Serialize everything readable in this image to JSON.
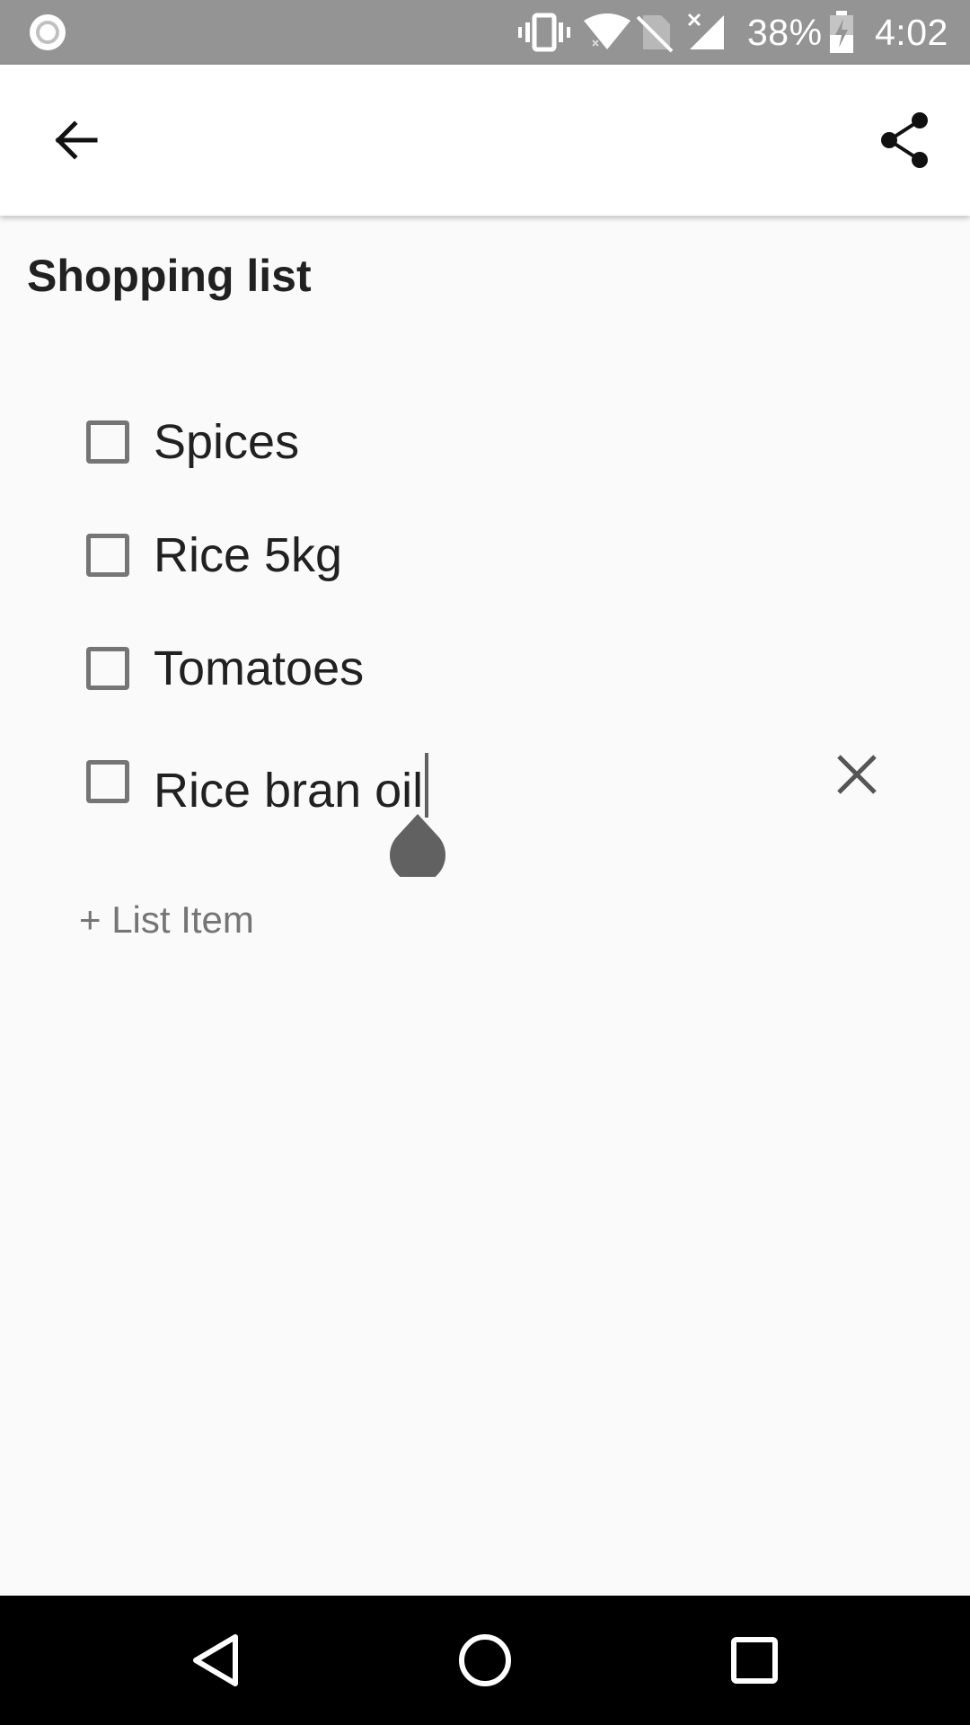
{
  "status_bar": {
    "battery_percent": "38%",
    "time": "4:02",
    "icons": [
      "notification-dot-icon",
      "vibrate-icon",
      "wifi-icon",
      "no-sim-icon",
      "signal-no-data-icon",
      "battery-charging-icon"
    ]
  },
  "app_bar": {
    "back_icon": "arrow-back-icon",
    "share_icon": "share-icon"
  },
  "note": {
    "title": "Shopping list",
    "items": [
      {
        "label": "Spices",
        "checked": false
      },
      {
        "label": "Rice 5kg",
        "checked": false
      },
      {
        "label": "Tomatoes",
        "checked": false
      },
      {
        "label": "Rice bran oil",
        "checked": false,
        "editing": true
      }
    ],
    "add_item_label": "+ List Item"
  },
  "nav_bar": {
    "icons": [
      "back-triangle-icon",
      "home-circle-icon",
      "recents-square-icon"
    ]
  },
  "colors": {
    "status_bar": "#949494",
    "app_bar": "#ffffff",
    "background": "#fafafa",
    "text_primary": "#212121",
    "text_secondary": "#757575",
    "nav_bar": "#000000"
  }
}
